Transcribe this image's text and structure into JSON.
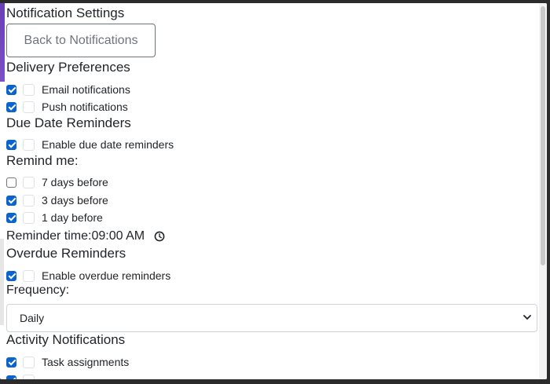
{
  "header": {
    "title": "Notification Settings",
    "back_button": "Back to Notifications"
  },
  "delivery": {
    "heading": "Delivery Preferences",
    "items": [
      {
        "label": "Email notifications",
        "checked": true
      },
      {
        "label": "Push notifications",
        "checked": true
      }
    ]
  },
  "due_date": {
    "heading": "Due Date Reminders",
    "enable": {
      "label": "Enable due date reminders",
      "checked": true
    },
    "remind_label": "Remind me:",
    "options": [
      {
        "label": "7 days before",
        "checked": false
      },
      {
        "label": "3 days before",
        "checked": true
      },
      {
        "label": "1 day before",
        "checked": true
      }
    ],
    "reminder_time_label": "Reminder time:",
    "reminder_time_value": "09:00 AM"
  },
  "overdue": {
    "heading": "Overdue Reminders",
    "enable": {
      "label": "Enable overdue reminders",
      "checked": true
    },
    "frequency_label": "Frequency:",
    "frequency_value": "Daily"
  },
  "activity": {
    "heading": "Activity Notifications",
    "items": [
      {
        "label": "Task assignments",
        "checked": true
      }
    ]
  },
  "colors": {
    "accent": "#6a3fb5",
    "checkbox_checked": "#0b63ce"
  },
  "icons": {
    "clock": "clock-icon",
    "chevron": "chevron-down-icon"
  }
}
